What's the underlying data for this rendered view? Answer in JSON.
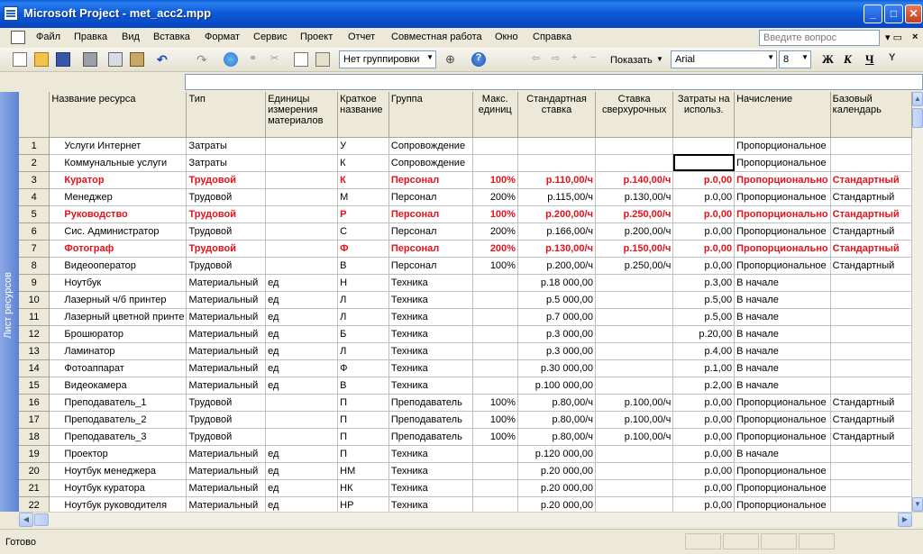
{
  "window": {
    "title": "Microsoft Project - met_acc2.mpp"
  },
  "menu": [
    "Файл",
    "Правка",
    "Вид",
    "Вставка",
    "Формат",
    "Сервис",
    "Проект",
    "Отчет",
    "Совместная работа",
    "Окно",
    "Справка"
  ],
  "ask_placeholder": "Введите вопрос",
  "toolbar": {
    "grouping": "Нет группировки",
    "show_label": "Показать",
    "font": "Arial",
    "font_size": "8",
    "bold": "Ж",
    "italic": "К",
    "underline": "Ч"
  },
  "view_label": "Лист ресурсов",
  "columns": [
    "Название ресурса",
    "Тип",
    "Единицы измерения материалов",
    "Краткое название",
    "Группа",
    "Макс. единиц",
    "Стандартная ставка",
    "Ставка сверхурочных",
    "Затраты на использ.",
    "Начисление",
    "Базовый календарь"
  ],
  "rows": [
    [
      "1",
      "Услуги Интернет",
      "Затраты",
      "",
      "У",
      "Сопровождение",
      "",
      "",
      "",
      "",
      "Пропорциональное",
      ""
    ],
    [
      "2",
      "Коммунальные услуги",
      "Затраты",
      "",
      "К",
      "Сопровождение",
      "",
      "",
      "",
      "",
      "Пропорциональное",
      ""
    ],
    [
      "3",
      "Куратор",
      "Трудовой",
      "",
      "К",
      "Персонал",
      "100%",
      "р.110,00/ч",
      "р.140,00/ч",
      "р.0,00",
      "Пропорционально",
      "Стандартный"
    ],
    [
      "4",
      "Менеджер",
      "Трудовой",
      "",
      "М",
      "Персонал",
      "200%",
      "р.115,00/ч",
      "р.130,00/ч",
      "р.0,00",
      "Пропорциональное",
      "Стандартный"
    ],
    [
      "5",
      "Руководство",
      "Трудовой",
      "",
      "Р",
      "Персонал",
      "100%",
      "р.200,00/ч",
      "р.250,00/ч",
      "р.0,00",
      "Пропорционально",
      "Стандартный"
    ],
    [
      "6",
      "Сис. Администратор",
      "Трудовой",
      "",
      "С",
      "Персонал",
      "200%",
      "р.166,00/ч",
      "р.200,00/ч",
      "р.0,00",
      "Пропорциональное",
      "Стандартный"
    ],
    [
      "7",
      "Фотограф",
      "Трудовой",
      "",
      "Ф",
      "Персонал",
      "200%",
      "р.130,00/ч",
      "р.150,00/ч",
      "р.0,00",
      "Пропорционально",
      "Стандартный"
    ],
    [
      "8",
      "Видеооператор",
      "Трудовой",
      "",
      "В",
      "Персонал",
      "100%",
      "р.200,00/ч",
      "р.250,00/ч",
      "р.0,00",
      "Пропорциональное",
      "Стандартный"
    ],
    [
      "9",
      "Ноутбук",
      "Материальный",
      "ед",
      "Н",
      "Техника",
      "",
      "р.18 000,00",
      "",
      "р.3,00",
      "В начале",
      ""
    ],
    [
      "10",
      "Лазерный ч/б принтер",
      "Материальный",
      "ед",
      "Л",
      "Техника",
      "",
      "р.5 000,00",
      "",
      "р.5,00",
      "В начале",
      ""
    ],
    [
      "11",
      "Лазерный цветной принте",
      "Материальный",
      "ед",
      "Л",
      "Техника",
      "",
      "р.7 000,00",
      "",
      "р.5,00",
      "В начале",
      ""
    ],
    [
      "12",
      "Брошюратор",
      "Материальный",
      "ед",
      "Б",
      "Техника",
      "",
      "р.3 000,00",
      "",
      "р.20,00",
      "В начале",
      ""
    ],
    [
      "13",
      "Ламинатор",
      "Материальный",
      "ед",
      "Л",
      "Техника",
      "",
      "р.3 000,00",
      "",
      "р.4,00",
      "В начале",
      ""
    ],
    [
      "14",
      "Фотоаппарат",
      "Материальный",
      "ед",
      "Ф",
      "Техника",
      "",
      "р.30 000,00",
      "",
      "р.1,00",
      "В начале",
      ""
    ],
    [
      "15",
      "Видеокамера",
      "Материальный",
      "ед",
      "В",
      "Техника",
      "",
      "р.100 000,00",
      "",
      "р.2,00",
      "В начале",
      ""
    ],
    [
      "16",
      "Преподаватель_1",
      "Трудовой",
      "",
      "П",
      "Преподаватель",
      "100%",
      "р.80,00/ч",
      "р.100,00/ч",
      "р.0,00",
      "Пропорциональное",
      "Стандартный"
    ],
    [
      "17",
      "Преподаватель_2",
      "Трудовой",
      "",
      "П",
      "Преподаватель",
      "100%",
      "р.80,00/ч",
      "р.100,00/ч",
      "р.0,00",
      "Пропорциональное",
      "Стандартный"
    ],
    [
      "18",
      "Преподаватель_3",
      "Трудовой",
      "",
      "П",
      "Преподаватель",
      "100%",
      "р.80,00/ч",
      "р.100,00/ч",
      "р.0,00",
      "Пропорциональное",
      "Стандартный"
    ],
    [
      "19",
      "Проектор",
      "Материальный",
      "ед",
      "П",
      "Техника",
      "",
      "р.120 000,00",
      "",
      "р.0,00",
      "В начале",
      ""
    ],
    [
      "20",
      "Ноутбук менеджера",
      "Материальный",
      "ед",
      "НМ",
      "Техника",
      "",
      "р.20 000,00",
      "",
      "р.0,00",
      "Пропорциональное",
      ""
    ],
    [
      "21",
      "Ноутбук куратора",
      "Материальный",
      "ед",
      "НК",
      "Техника",
      "",
      "р.20 000,00",
      "",
      "р.0,00",
      "Пропорциональное",
      ""
    ],
    [
      "22",
      "Ноутбук руководителя",
      "Материальный",
      "ед",
      "НР",
      "Техника",
      "",
      "р.20 000,00",
      "",
      "р.0,00",
      "Пропорциональное",
      ""
    ]
  ],
  "highlight_rows": [
    "3",
    "5",
    "7"
  ],
  "highlight_color": "#e8101a",
  "status": "Готово"
}
